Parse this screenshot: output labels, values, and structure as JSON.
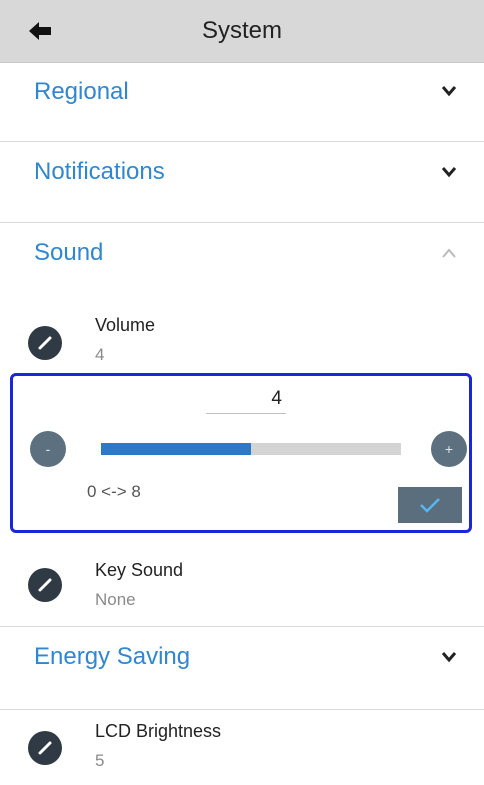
{
  "header": {
    "title": "System"
  },
  "sections": {
    "regional": "Regional",
    "notifications": "Notifications",
    "sound": "Sound",
    "energy_saving": "Energy Saving"
  },
  "sound": {
    "volume": {
      "label": "Volume",
      "value": "4"
    },
    "editor": {
      "value": "4",
      "minus": "-",
      "plus": "+",
      "range": "0 <-> 8",
      "level_fraction": 0.5
    },
    "key_sound": {
      "label": "Key Sound",
      "value": "None"
    }
  },
  "energy_saving": {
    "lcd_brightness": {
      "label": "LCD Brightness",
      "value": "5"
    }
  },
  "colors": {
    "accent": "#2f87d2",
    "focus": "#1a27d8",
    "header_bg": "#d8d8d8"
  },
  "icons": [
    "back-arrow-icon",
    "chevron-down-icon",
    "chevron-up-icon",
    "edit-pencil-icon",
    "checkmark-icon"
  ]
}
